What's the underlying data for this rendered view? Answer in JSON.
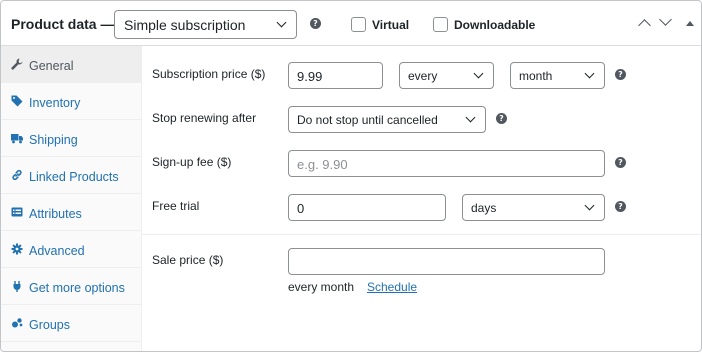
{
  "header": {
    "title": "Product data —",
    "product_type": "Simple subscription",
    "virtual_label": "Virtual",
    "downloadable_label": "Downloadable"
  },
  "icons": {
    "help": "?",
    "general": "wrench-icon",
    "inventory": "tag-icon",
    "shipping": "truck-icon",
    "linked": "link-icon",
    "attributes": "list-icon",
    "advanced": "gear-icon",
    "more": "plugin-icon",
    "groups": "groups-icon"
  },
  "sidebar": {
    "items": [
      {
        "label": "General",
        "active": true
      },
      {
        "label": "Inventory"
      },
      {
        "label": "Shipping"
      },
      {
        "label": "Linked Products"
      },
      {
        "label": "Attributes"
      },
      {
        "label": "Advanced"
      },
      {
        "label": "Get more options"
      },
      {
        "label": "Groups"
      }
    ]
  },
  "form": {
    "subscription_price": {
      "label": "Subscription price ($)",
      "value": "9.99",
      "interval": "every",
      "period": "month"
    },
    "stop_renewing": {
      "label": "Stop renewing after",
      "value": "Do not stop until cancelled"
    },
    "signup_fee": {
      "label": "Sign-up fee ($)",
      "placeholder": "e.g. 9.90"
    },
    "free_trial": {
      "label": "Free trial",
      "value": "0",
      "period": "days"
    },
    "sale_price": {
      "label": "Sale price ($)",
      "value": "",
      "note": "every month",
      "schedule_link": "Schedule"
    }
  },
  "colors": {
    "link": "#2271b1",
    "border": "#8c8f94",
    "active_tab_bg": "#eeeeee",
    "sidebar_bg": "#fafafa"
  }
}
